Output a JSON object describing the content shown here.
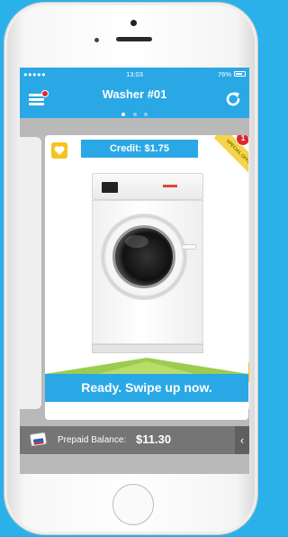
{
  "status_bar": {
    "carrier": "●●●●● ",
    "time": "13:03",
    "right": "76%"
  },
  "header": {
    "title": "Washer #01",
    "pages_total": 3,
    "page_active": 0
  },
  "machine_card": {
    "credit": "Credit: $1.75",
    "ribbon_text": "SPECIAL OFFER",
    "ribbon_badge": "1",
    "cta": "Ready. Swipe up now."
  },
  "balance_bar": {
    "label": "Prepaid Balance:",
    "value": "$11.30",
    "arrow": "‹"
  },
  "colors": {
    "accent": "#2aa8e5",
    "background": "#2bb1ea",
    "highlight": "#f6c323",
    "badge": "#e3262e"
  },
  "icons": [
    "menu-icon",
    "refresh-icon",
    "favorite-icon",
    "payment-card-icon",
    "chevron-left-icon"
  ]
}
